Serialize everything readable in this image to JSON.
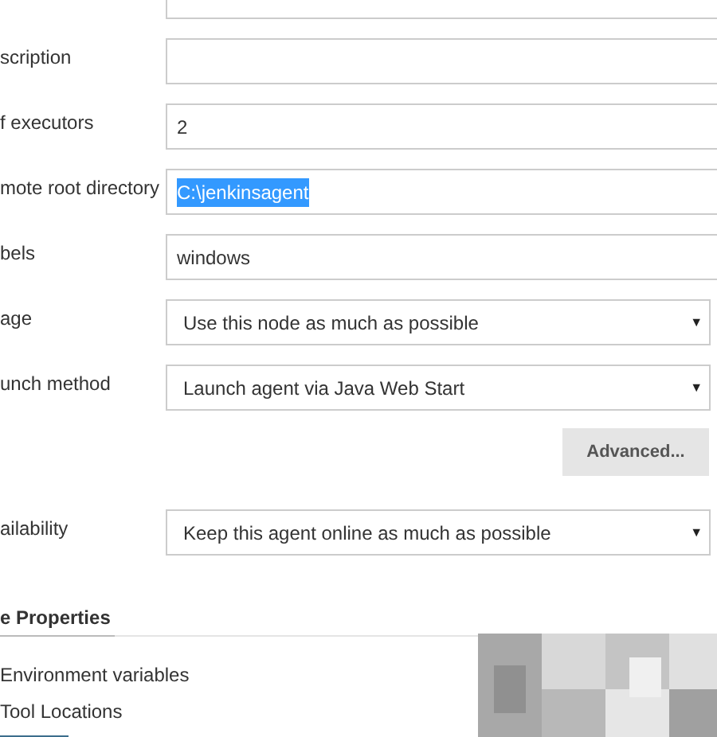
{
  "fields": [
    {
      "kind": "text",
      "label": "scription"
    },
    {
      "kind": "text",
      "label": "f executors",
      "value": "2"
    },
    {
      "kind": "text",
      "label": "mote root directory",
      "value": "C:\\jenkinsagent",
      "text_selected": true
    },
    {
      "kind": "text",
      "label": "bels",
      "value": "windows"
    },
    {
      "kind": "select",
      "label": "age",
      "value": "Use this node as much as possible",
      "arrow": "▼"
    },
    {
      "kind": "select",
      "label": "unch method",
      "value": "Launch agent via Java Web Start",
      "arrow": "▼"
    },
    {
      "kind": "button",
      "label": "Advanced..."
    },
    {
      "kind": "select",
      "label": "ailability",
      "value": "Keep this agent online as much as possible",
      "arrow": "▼"
    }
  ],
  "section": {
    "title": "e Properties",
    "options": [
      {
        "label": "Environment variables"
      },
      {
        "label": "Tool Locations"
      }
    ]
  }
}
